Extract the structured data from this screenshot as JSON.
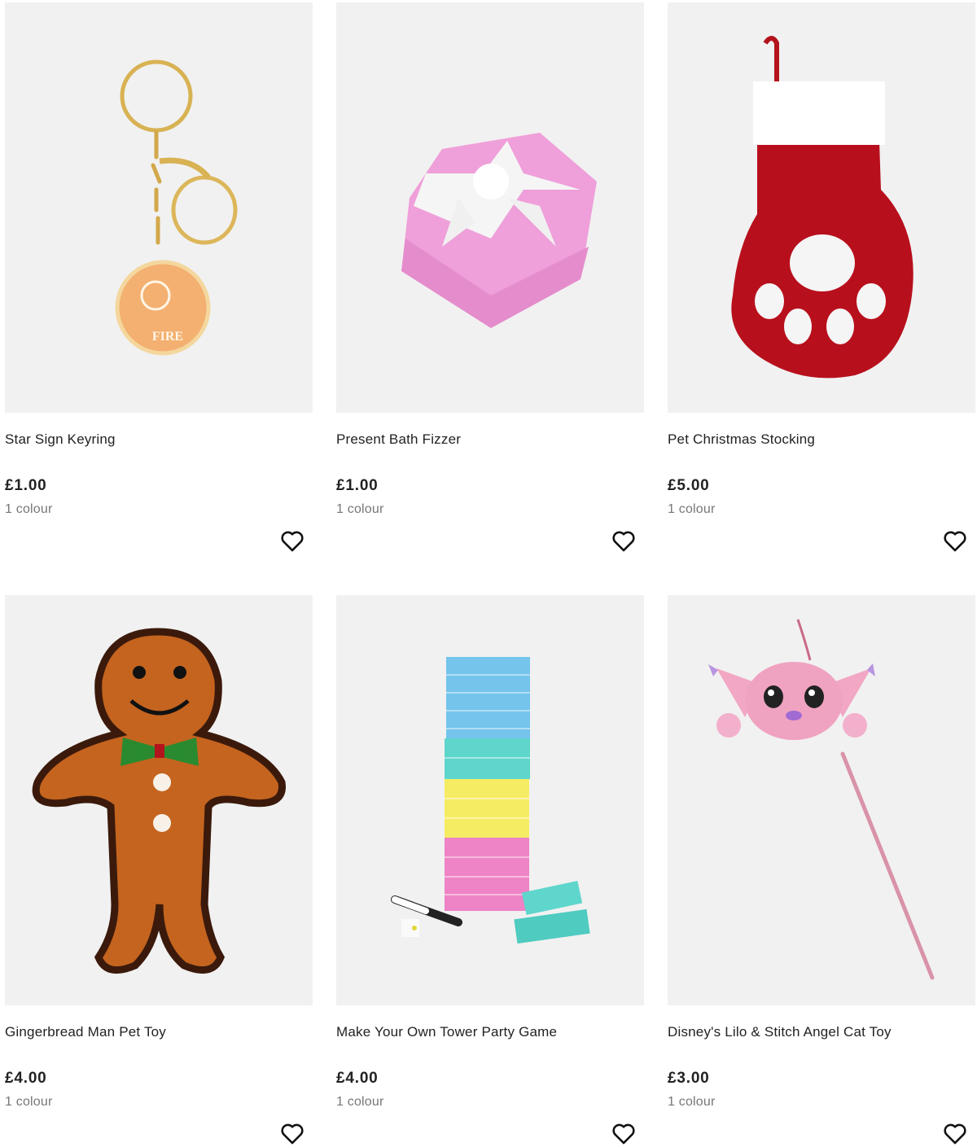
{
  "products": [
    {
      "title": "Star Sign Keyring",
      "price": "£1.00",
      "colours": "1 colour",
      "image_icon": "keyring-image"
    },
    {
      "title": "Present Bath Fizzer",
      "price": "£1.00",
      "colours": "1 colour",
      "image_icon": "bath-fizzer-image"
    },
    {
      "title": "Pet Christmas Stocking",
      "price": "£5.00",
      "colours": "1 colour",
      "image_icon": "stocking-image"
    },
    {
      "title": "Gingerbread Man Pet Toy",
      "price": "£4.00",
      "colours": "1 colour",
      "image_icon": "gingerbread-toy-image"
    },
    {
      "title": "Make Your Own Tower Party Game",
      "price": "£4.00",
      "colours": "1 colour",
      "image_icon": "tower-game-image"
    },
    {
      "title": "Disney's Lilo & Stitch Angel Cat Toy",
      "price": "£3.00",
      "colours": "1 colour",
      "image_icon": "cat-toy-image"
    }
  ],
  "colors": {
    "image_bg": "#f1f1f1",
    "text": "#222222",
    "muted": "#777777"
  }
}
